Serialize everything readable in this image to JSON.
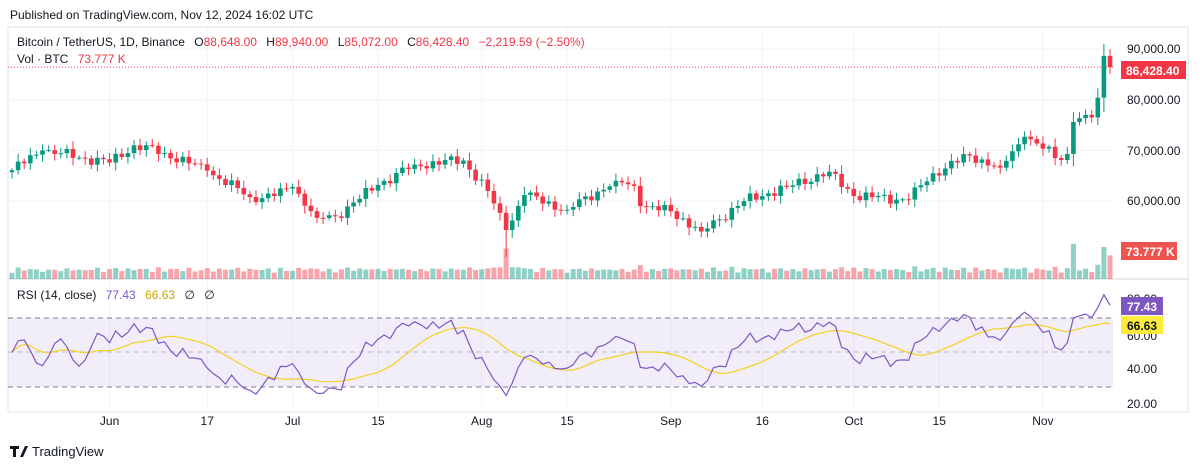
{
  "published": "Published on TradingView.com, Nov 12, 2024 16:02 UTC",
  "legend": {
    "symbol": "Bitcoin / TetherUS, 1D, Binance",
    "o_label": "O",
    "o": "88,648.00",
    "h_label": "H",
    "h": "89,940.00",
    "l_label": "L",
    "l": "85,072.00",
    "c_label": "C",
    "c": "86,428.40",
    "change": "−2,219.59 (−2.50%)",
    "vol_label": "Vol · BTC",
    "vol": "73.777 K"
  },
  "rsi_legend": {
    "label": "RSI (14, close)",
    "rsi": "77.43",
    "ma": "66.63",
    "v3": "∅",
    "v4": "∅"
  },
  "price_axis": [
    "90,000.00",
    "80,000.00",
    "70,000.00",
    "60,000.00"
  ],
  "rsi_axis": [
    "80.00",
    "60.00",
    "40.00",
    "20.00"
  ],
  "time_axis": [
    {
      "label": "Jun",
      "day": 16
    },
    {
      "label": "17",
      "day": 32
    },
    {
      "label": "Jul",
      "day": 46
    },
    {
      "label": "15",
      "day": 60
    },
    {
      "label": "Aug",
      "day": 77
    },
    {
      "label": "15",
      "day": 91
    },
    {
      "label": "Sep",
      "day": 108
    },
    {
      "label": "16",
      "day": 123
    },
    {
      "label": "Oct",
      "day": 138
    },
    {
      "label": "15",
      "day": 152
    },
    {
      "label": "Nov",
      "day": 169
    }
  ],
  "last_price_label": "86,428.40",
  "last_vol_label": "73.777 K",
  "rsi_value_label": "77.43",
  "rsi_ma_label": "66.63",
  "footer": {
    "brand": "TradingView"
  },
  "colors": {
    "up": "#089981",
    "down": "#f23645",
    "rsi": "#7e57c2",
    "rsi_ma": "#f5d020"
  },
  "chart_data": {
    "type": "candlestick",
    "title": "Bitcoin / TetherUS, 1D, Binance",
    "start_date": "2024-05-16",
    "days": 181,
    "close_keypoints": [
      [
        0,
        66100
      ],
      [
        5,
        70000
      ],
      [
        16,
        67600
      ],
      [
        20,
        71000
      ],
      [
        25,
        69500
      ],
      [
        32,
        66000
      ],
      [
        39,
        60800
      ],
      [
        43,
        61000
      ],
      [
        46,
        62800
      ],
      [
        50,
        56700
      ],
      [
        53,
        57000
      ],
      [
        60,
        63200
      ],
      [
        66,
        67200
      ],
      [
        74,
        68000
      ],
      [
        78,
        62000
      ],
      [
        81,
        54300
      ],
      [
        84,
        61200
      ],
      [
        91,
        58300
      ],
      [
        99,
        64000
      ],
      [
        102,
        63000
      ],
      [
        103,
        59000
      ],
      [
        108,
        58000
      ],
      [
        113,
        54000
      ],
      [
        120,
        60000
      ],
      [
        127,
        62800
      ],
      [
        134,
        65800
      ],
      [
        138,
        61000
      ],
      [
        147,
        60300
      ],
      [
        151,
        65500
      ],
      [
        157,
        69000
      ],
      [
        162,
        66600
      ],
      [
        166,
        72700
      ],
      [
        172,
        68100
      ],
      [
        173,
        69300
      ],
      [
        174,
        75600
      ],
      [
        177,
        76500
      ],
      [
        178,
        80400
      ],
      [
        179,
        88648
      ],
      [
        180,
        86428.4
      ]
    ],
    "last_candle": {
      "open": 88648,
      "high": 89940,
      "low": 85072,
      "close": 86428.4,
      "volume_k": 73.777
    },
    "volume_spikes_k": [
      [
        81,
        95
      ],
      [
        174,
        110
      ],
      [
        179,
        100
      ],
      [
        180,
        73.777
      ]
    ],
    "price_range": [
      50000,
      92000
    ],
    "rsi": {
      "period": 14,
      "last": 77.43,
      "ma_last": 66.63,
      "bands": [
        70,
        50,
        30
      ],
      "range": [
        20,
        85
      ]
    }
  }
}
